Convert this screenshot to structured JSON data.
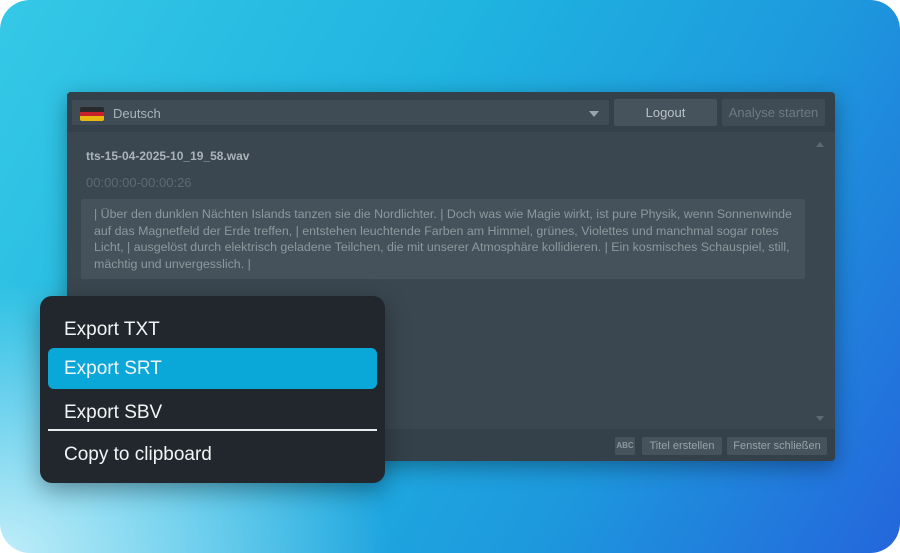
{
  "toolbar": {
    "language": "Deutsch",
    "logout_label": "Logout",
    "analyse_label": "Analyse starten",
    "flag_colors": [
      "#2a2a2a",
      "#c8202a",
      "#e8b80e"
    ]
  },
  "document": {
    "file_name": "tts-15-04-2025-10_19_58.wav",
    "time_range": "00:00:00-00:00:26",
    "transcript": "| Über den dunklen Nächten Islands tanzen sie die Nordlichter. | Doch was wie Magie wirkt, ist pure Physik, wenn Sonnenwinde auf das Magnetfeld der Erde treffen, | entstehen leuchtende Farben am Himmel, grünes, Violettes und manchmal sogar rotes Licht, | ausgelöst durch elektrisch geladene Teilchen, die mit unserer Atmosphäre kollidieren. | Ein kosmisches Schauspiel, still, mächtig und unvergesslich. |"
  },
  "bottombar": {
    "spellcheck_label": "ABC",
    "create_title_label": "Titel erstellen",
    "close_window_label": "Fenster schließen"
  },
  "context_menu": {
    "items": [
      {
        "label": "Export TXT"
      },
      {
        "label": "Export SRT",
        "highlighted": true
      },
      {
        "label": "Export SBV"
      },
      {
        "label": "Copy to clipboard"
      }
    ],
    "highlight_color": "#09a8d8"
  }
}
